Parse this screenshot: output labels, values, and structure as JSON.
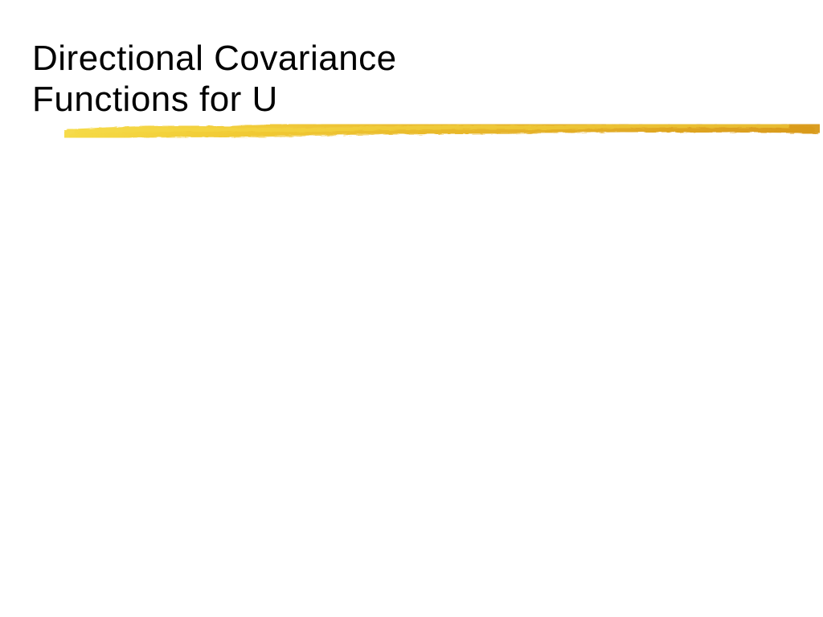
{
  "slide": {
    "title_line1": "Directional Covariance",
    "title_line2": "Functions for U"
  }
}
